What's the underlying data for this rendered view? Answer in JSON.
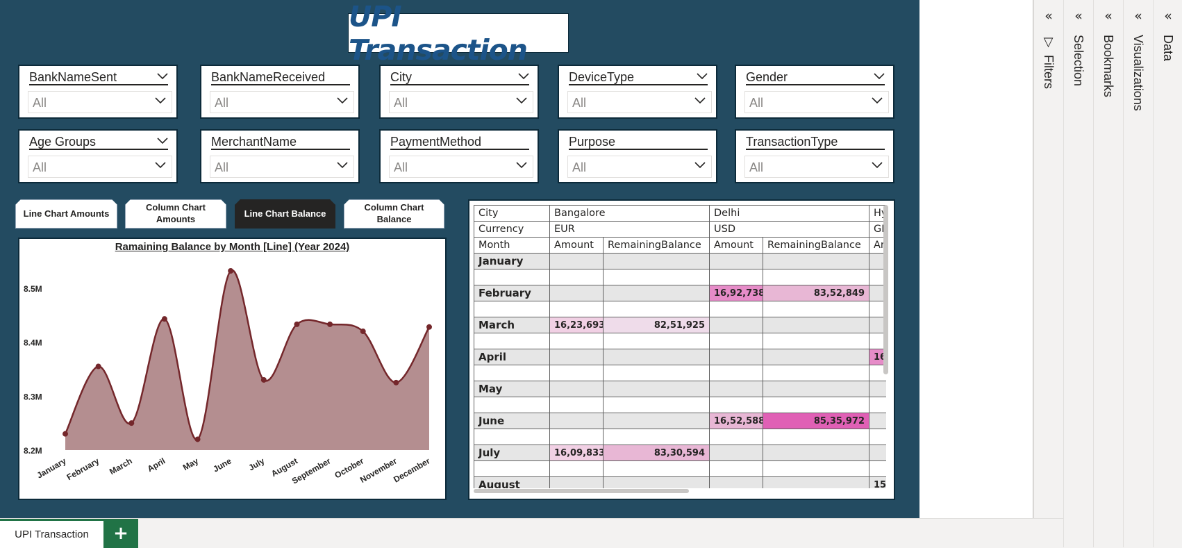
{
  "report": {
    "title": "UPI Transaction"
  },
  "slicers": [
    {
      "header": "BankNameSent",
      "value": "All"
    },
    {
      "header": "BankNameReceived",
      "value": "All"
    },
    {
      "header": "City",
      "value": "All"
    },
    {
      "header": "DeviceType",
      "value": "All"
    },
    {
      "header": "Gender",
      "value": "All"
    },
    {
      "header": "Age Groups",
      "value": "All"
    },
    {
      "header": "MerchantName",
      "value": "All"
    },
    {
      "header": "PaymentMethod",
      "value": "All"
    },
    {
      "header": "Purpose",
      "value": "All"
    },
    {
      "header": "TransactionType",
      "value": "All"
    }
  ],
  "toggle_buttons": [
    {
      "label": "Line Chart Amounts",
      "active": false
    },
    {
      "label": "Column Chart Amounts",
      "active": false
    },
    {
      "label": "Line Chart Balance",
      "active": true
    },
    {
      "label": "Column Chart Balance",
      "active": false
    }
  ],
  "chart_data": {
    "type": "area",
    "title": "Ramaining Balance by Month [Line] (Year 2024)",
    "xlabel": "",
    "ylabel": "",
    "categories": [
      "January",
      "February",
      "March",
      "April",
      "May",
      "June",
      "July",
      "August",
      "September",
      "October",
      "November",
      "December"
    ],
    "values": [
      8.23,
      8.355,
      8.25,
      8.443,
      8.22,
      8.532,
      8.33,
      8.433,
      8.433,
      8.42,
      8.325,
      8.428
    ],
    "yunit": "M",
    "ylim": [
      8.2,
      8.55
    ],
    "yticks": [
      "8.2M",
      "8.3M",
      "8.4M",
      "8.5M"
    ],
    "ytick_values": [
      8.2,
      8.3,
      8.4,
      8.5
    ],
    "line_color": "#74272b",
    "fill_color": "#b48e90",
    "grid": false
  },
  "matrix": {
    "row_header_labels": [
      "City",
      "Currency",
      "Month"
    ],
    "cities": [
      "Bangalore",
      "Delhi",
      "Hy"
    ],
    "currencies": [
      "EUR",
      "USD",
      "GE"
    ],
    "measures": [
      "Amount",
      "RemainingBalance",
      "Amount",
      "RemainingBalance",
      "An"
    ],
    "rows": [
      {
        "month": "January",
        "cells": [
          "",
          "",
          "",
          "",
          ""
        ]
      },
      {
        "month": "February",
        "cells": [
          "",
          "",
          "16,92,738",
          "83,52,849",
          ""
        ]
      },
      {
        "month": "March",
        "cells": [
          "16,23,693",
          "82,51,925",
          "",
          "",
          ""
        ]
      },
      {
        "month": "April",
        "cells": [
          "",
          "",
          "",
          "",
          "16"
        ]
      },
      {
        "month": "May",
        "cells": [
          "",
          "",
          "",
          "",
          ""
        ]
      },
      {
        "month": "June",
        "cells": [
          "",
          "",
          "16,52,588",
          "85,35,972",
          ""
        ]
      },
      {
        "month": "July",
        "cells": [
          "16,09,833",
          "83,30,594",
          "",
          "",
          ""
        ]
      },
      {
        "month": "August",
        "cells": [
          "",
          "",
          "",
          "",
          "15"
        ]
      }
    ],
    "heat_colors": {
      "February": [
        "",
        "",
        "#e68cc8",
        "#e8b7d5",
        ""
      ],
      "March": [
        "#f1d0e4",
        "#efdcea",
        "",
        "",
        ""
      ],
      "April": [
        "",
        "",
        "",
        "",
        "#e68cc8"
      ],
      "June": [
        "",
        "",
        "#e8b7d5",
        "#e060b5",
        ""
      ],
      "July": [
        "#f1d0e4",
        "#e8b7d5",
        "",
        "",
        ""
      ]
    }
  },
  "panes": [
    {
      "label": "Filters"
    },
    {
      "label": "Selection"
    },
    {
      "label": "Bookmarks"
    },
    {
      "label": "Visualizations"
    },
    {
      "label": "Data"
    }
  ],
  "bottom_bar": {
    "page_tab": "UPI Transaction",
    "add_page_icon": "+"
  }
}
